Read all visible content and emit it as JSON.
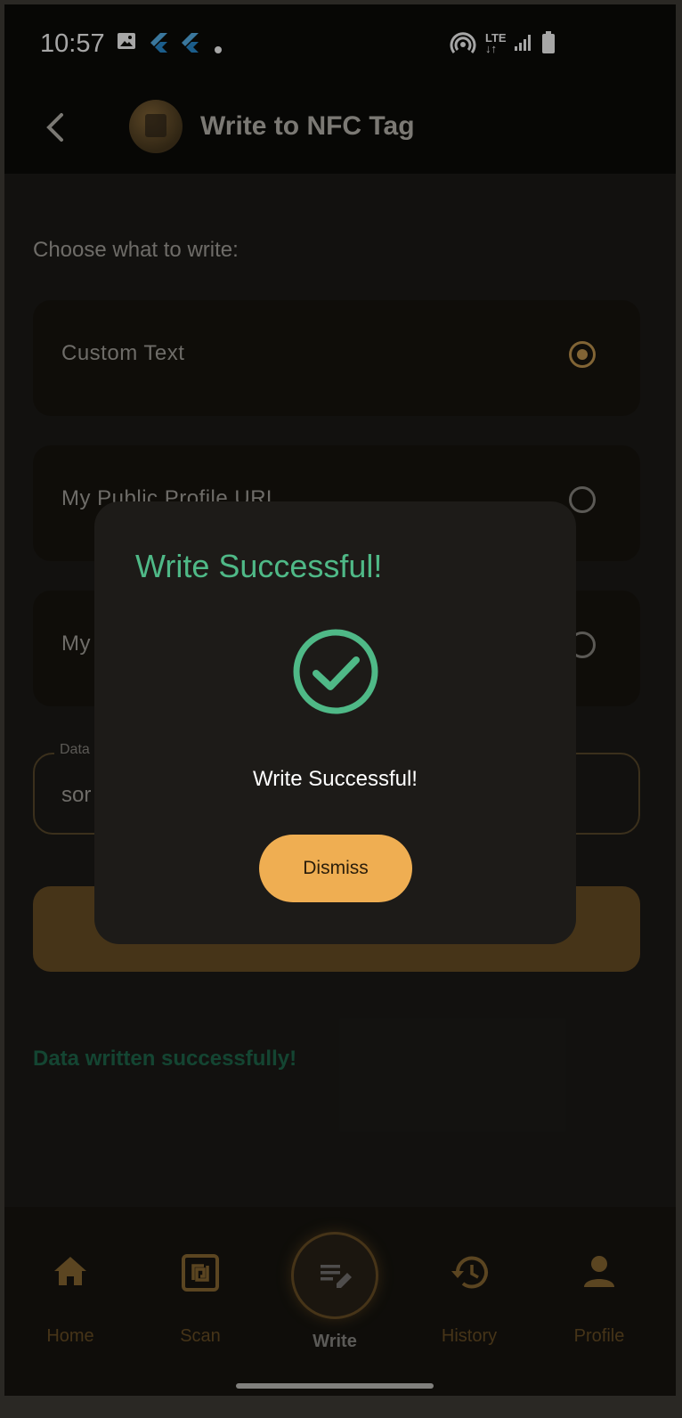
{
  "status_bar": {
    "time": "10:57",
    "network": "LTE"
  },
  "app_bar": {
    "title": "Write to NFC Tag"
  },
  "content": {
    "choose_label": "Choose what to write:",
    "options": [
      {
        "label": "Custom Text",
        "selected": true
      },
      {
        "label": "My Public Profile URL",
        "selected": false
      },
      {
        "label": "My",
        "selected": false
      }
    ],
    "data_field": {
      "label": "Data",
      "value": "sor"
    },
    "status_message": "Data written successfully!"
  },
  "dialog": {
    "title": "Write Successful!",
    "message": "Write Successful!",
    "dismiss_label": "Dismiss",
    "icon": "check-circle-icon"
  },
  "bottom_nav": {
    "items": [
      {
        "label": "Home",
        "icon": "home-icon"
      },
      {
        "label": "Scan",
        "icon": "nfc-icon"
      },
      {
        "label": "Write",
        "icon": "edit-note-icon",
        "active": true
      },
      {
        "label": "History",
        "icon": "history-icon"
      },
      {
        "label": "Profile",
        "icon": "person-icon"
      }
    ]
  },
  "colors": {
    "accent": "#efae52",
    "success": "#4fb987",
    "background": "#1d1b18",
    "muted_gold": "#6c5026"
  }
}
